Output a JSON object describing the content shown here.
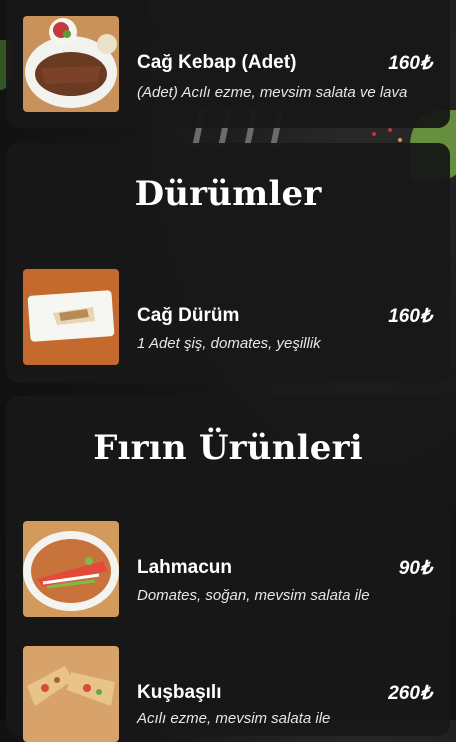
{
  "sections": [
    {
      "title": "",
      "items": [
        {
          "name": "Cağ Kebap (Adet)",
          "price": "160₺",
          "description": "(Adet) Acılı ezme, mevsim salata ve lava",
          "image": "kebab-plate-image"
        }
      ]
    },
    {
      "title": "Dürümler",
      "items": [
        {
          "name": "Cağ Dürüm",
          "price": "160₺",
          "description": "1 Adet şiş, domates, yeşillik",
          "image": "wrap-plate-image"
        }
      ]
    },
    {
      "title": "Fırın Ürünleri",
      "items": [
        {
          "name": "Lahmacun",
          "price": "90₺",
          "description": "Domates, soğan, mevsim salata ile",
          "image": "lahmacun-plate-image"
        },
        {
          "name": "Kuşbaşılı",
          "price": "260₺",
          "description": "Acılı ezme, mevsim salata ile",
          "image": "pide-plate-image"
        }
      ]
    }
  ],
  "colors": {
    "card": "#181818",
    "background": "#111111",
    "text": "#ffffff"
  }
}
